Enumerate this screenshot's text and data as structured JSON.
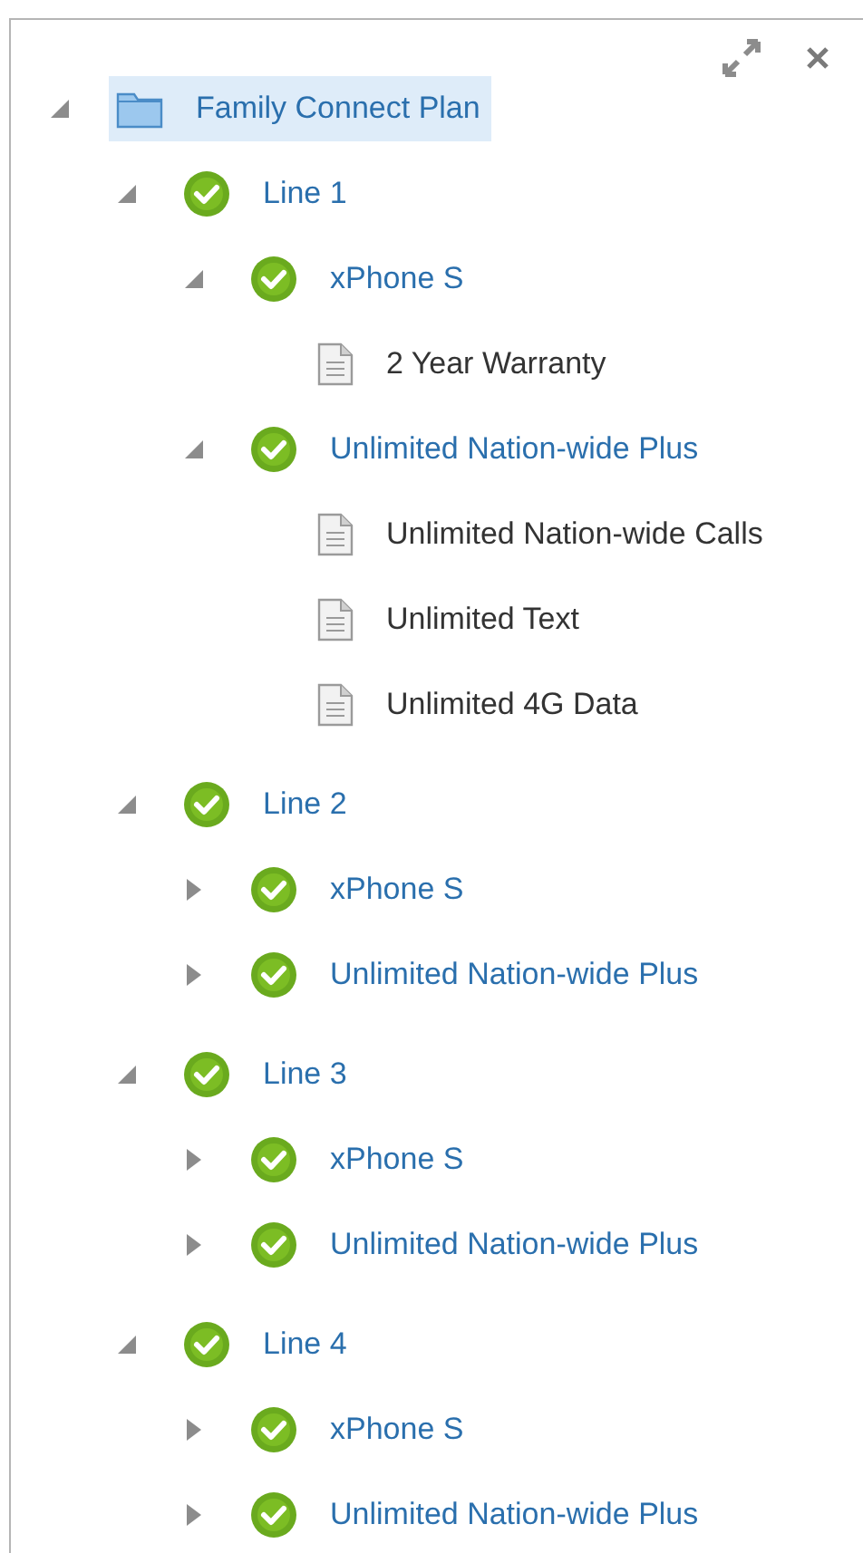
{
  "tree": [
    {
      "label": "Family Connect Plan",
      "kind": "folder",
      "selected": true,
      "expanded": true,
      "children": [
        {
          "label": "Line 1",
          "kind": "check",
          "selected": false,
          "expanded": true,
          "children": [
            {
              "label": "xPhone S",
              "kind": "check",
              "selected": false,
              "expanded": true,
              "children": [
                {
                  "label": "2 Year Warranty",
                  "kind": "document",
                  "selected": false
                }
              ]
            },
            {
              "label": "Unlimited Nation-wide Plus",
              "kind": "check",
              "selected": false,
              "expanded": true,
              "children": [
                {
                  "label": "Unlimited Nation-wide Calls",
                  "kind": "document",
                  "selected": false
                },
                {
                  "label": "Unlimited Text",
                  "kind": "document",
                  "selected": false
                },
                {
                  "label": "Unlimited 4G Data",
                  "kind": "document",
                  "selected": false
                }
              ]
            }
          ]
        },
        {
          "label": "Line 2",
          "kind": "check",
          "selected": false,
          "expanded": true,
          "children": [
            {
              "label": "xPhone S",
              "kind": "check",
              "selected": false,
              "expanded": false
            },
            {
              "label": "Unlimited Nation-wide Plus",
              "kind": "check",
              "selected": false,
              "expanded": false
            }
          ]
        },
        {
          "label": "Line 3",
          "kind": "check",
          "selected": false,
          "expanded": true,
          "children": [
            {
              "label": "xPhone S",
              "kind": "check",
              "selected": false,
              "expanded": false
            },
            {
              "label": "Unlimited Nation-wide Plus",
              "kind": "check",
              "selected": false,
              "expanded": false
            }
          ]
        },
        {
          "label": "Line 4",
          "kind": "check",
          "selected": false,
          "expanded": true,
          "children": [
            {
              "label": "xPhone S",
              "kind": "check",
              "selected": false,
              "expanded": false
            },
            {
              "label": "Unlimited Nation-wide Plus",
              "kind": "check",
              "selected": false,
              "expanded": false
            }
          ]
        }
      ]
    }
  ]
}
